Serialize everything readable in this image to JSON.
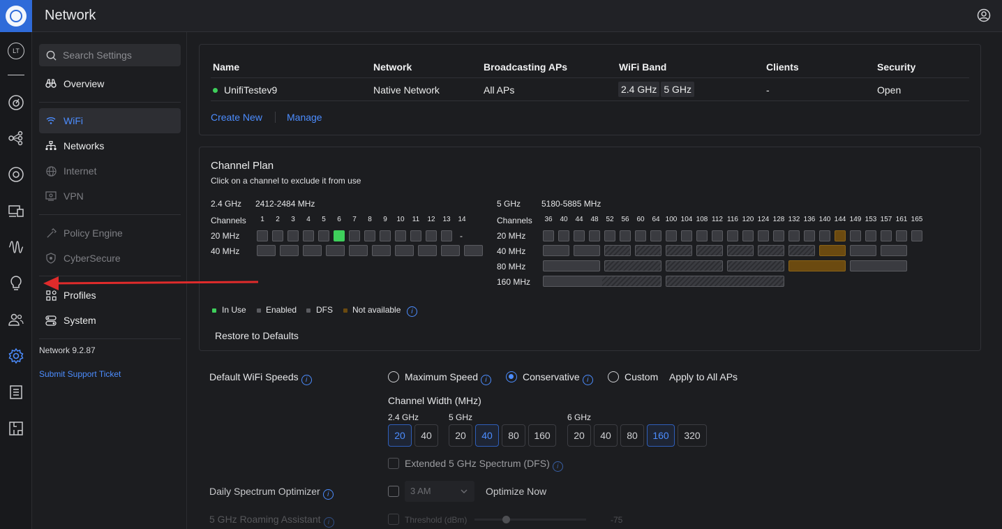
{
  "app": {
    "title": "Network"
  },
  "rail": {
    "avatar_initials": "LT"
  },
  "sidebar": {
    "search_placeholder": "Search Settings",
    "items": [
      {
        "label": "Overview"
      },
      {
        "label": "WiFi"
      },
      {
        "label": "Networks"
      },
      {
        "label": "Internet"
      },
      {
        "label": "VPN"
      },
      {
        "label": "Policy Engine"
      },
      {
        "label": "CyberSecure"
      },
      {
        "label": "Profiles"
      },
      {
        "label": "System"
      }
    ],
    "version": "Network 9.2.87",
    "support_link": "Submit Support Ticket"
  },
  "wifi_table": {
    "headers": [
      "Name",
      "Network",
      "Broadcasting APs",
      "WiFi Band",
      "Clients",
      "Security"
    ],
    "row": {
      "name": "UnifiTestev9",
      "network": "Native Network",
      "aps": "All APs",
      "bands": [
        "2.4 GHz",
        "5 GHz"
      ],
      "clients": "-",
      "security": "Open"
    },
    "create_new": "Create New",
    "manage": "Manage"
  },
  "channel_plan": {
    "title": "Channel Plan",
    "subtitle": "Click on a channel to exclude it from use",
    "band24": {
      "label": "2.4 GHz",
      "range": "2412-2484 MHz",
      "channels": [
        "1",
        "2",
        "3",
        "4",
        "5",
        "6",
        "7",
        "8",
        "9",
        "10",
        "11",
        "12",
        "13",
        "14"
      ],
      "in_use": "6",
      "no14": "-"
    },
    "band5": {
      "label": "5 GHz",
      "range": "5180-5885 MHz",
      "channels": [
        "36",
        "40",
        "44",
        "48",
        "52",
        "56",
        "60",
        "64",
        "100",
        "104",
        "108",
        "112",
        "116",
        "120",
        "124",
        "128",
        "132",
        "136",
        "140",
        "144",
        "149",
        "153",
        "157",
        "161",
        "165"
      ]
    },
    "channels_label": "Channels",
    "widths": [
      "20 MHz",
      "40 MHz",
      "80 MHz",
      "160 MHz"
    ],
    "legend": [
      "In Use",
      "Enabled",
      "DFS",
      "Not available"
    ],
    "colors": {
      "in_use": "#3ecf5b",
      "enabled": "#3a3b40",
      "not_available": "#6b4a10"
    },
    "restore": "Restore to Defaults"
  },
  "speeds": {
    "label": "Default WiFi Speeds",
    "options": [
      "Maximum Speed",
      "Conservative",
      "Custom"
    ],
    "selected": "Conservative",
    "apply": "Apply to All APs",
    "width_title": "Channel Width (MHz)",
    "g24": {
      "label": "2.4 GHz",
      "values": [
        "20",
        "40"
      ],
      "selected": "20"
    },
    "g5": {
      "label": "5 GHz",
      "values": [
        "20",
        "40",
        "80",
        "160"
      ],
      "selected": "40"
    },
    "g6": {
      "label": "6 GHz",
      "values": [
        "20",
        "40",
        "80",
        "160",
        "320"
      ],
      "selected": "160"
    },
    "dfs": "Extended 5 GHz Spectrum (DFS)"
  },
  "optimizer": {
    "label": "Daily Spectrum Optimizer",
    "time": "3 AM",
    "action": "Optimize Now"
  },
  "roaming": {
    "label": "5 GHz Roaming Assistant",
    "threshold_label": "Threshold (dBm)",
    "value": "-75"
  }
}
